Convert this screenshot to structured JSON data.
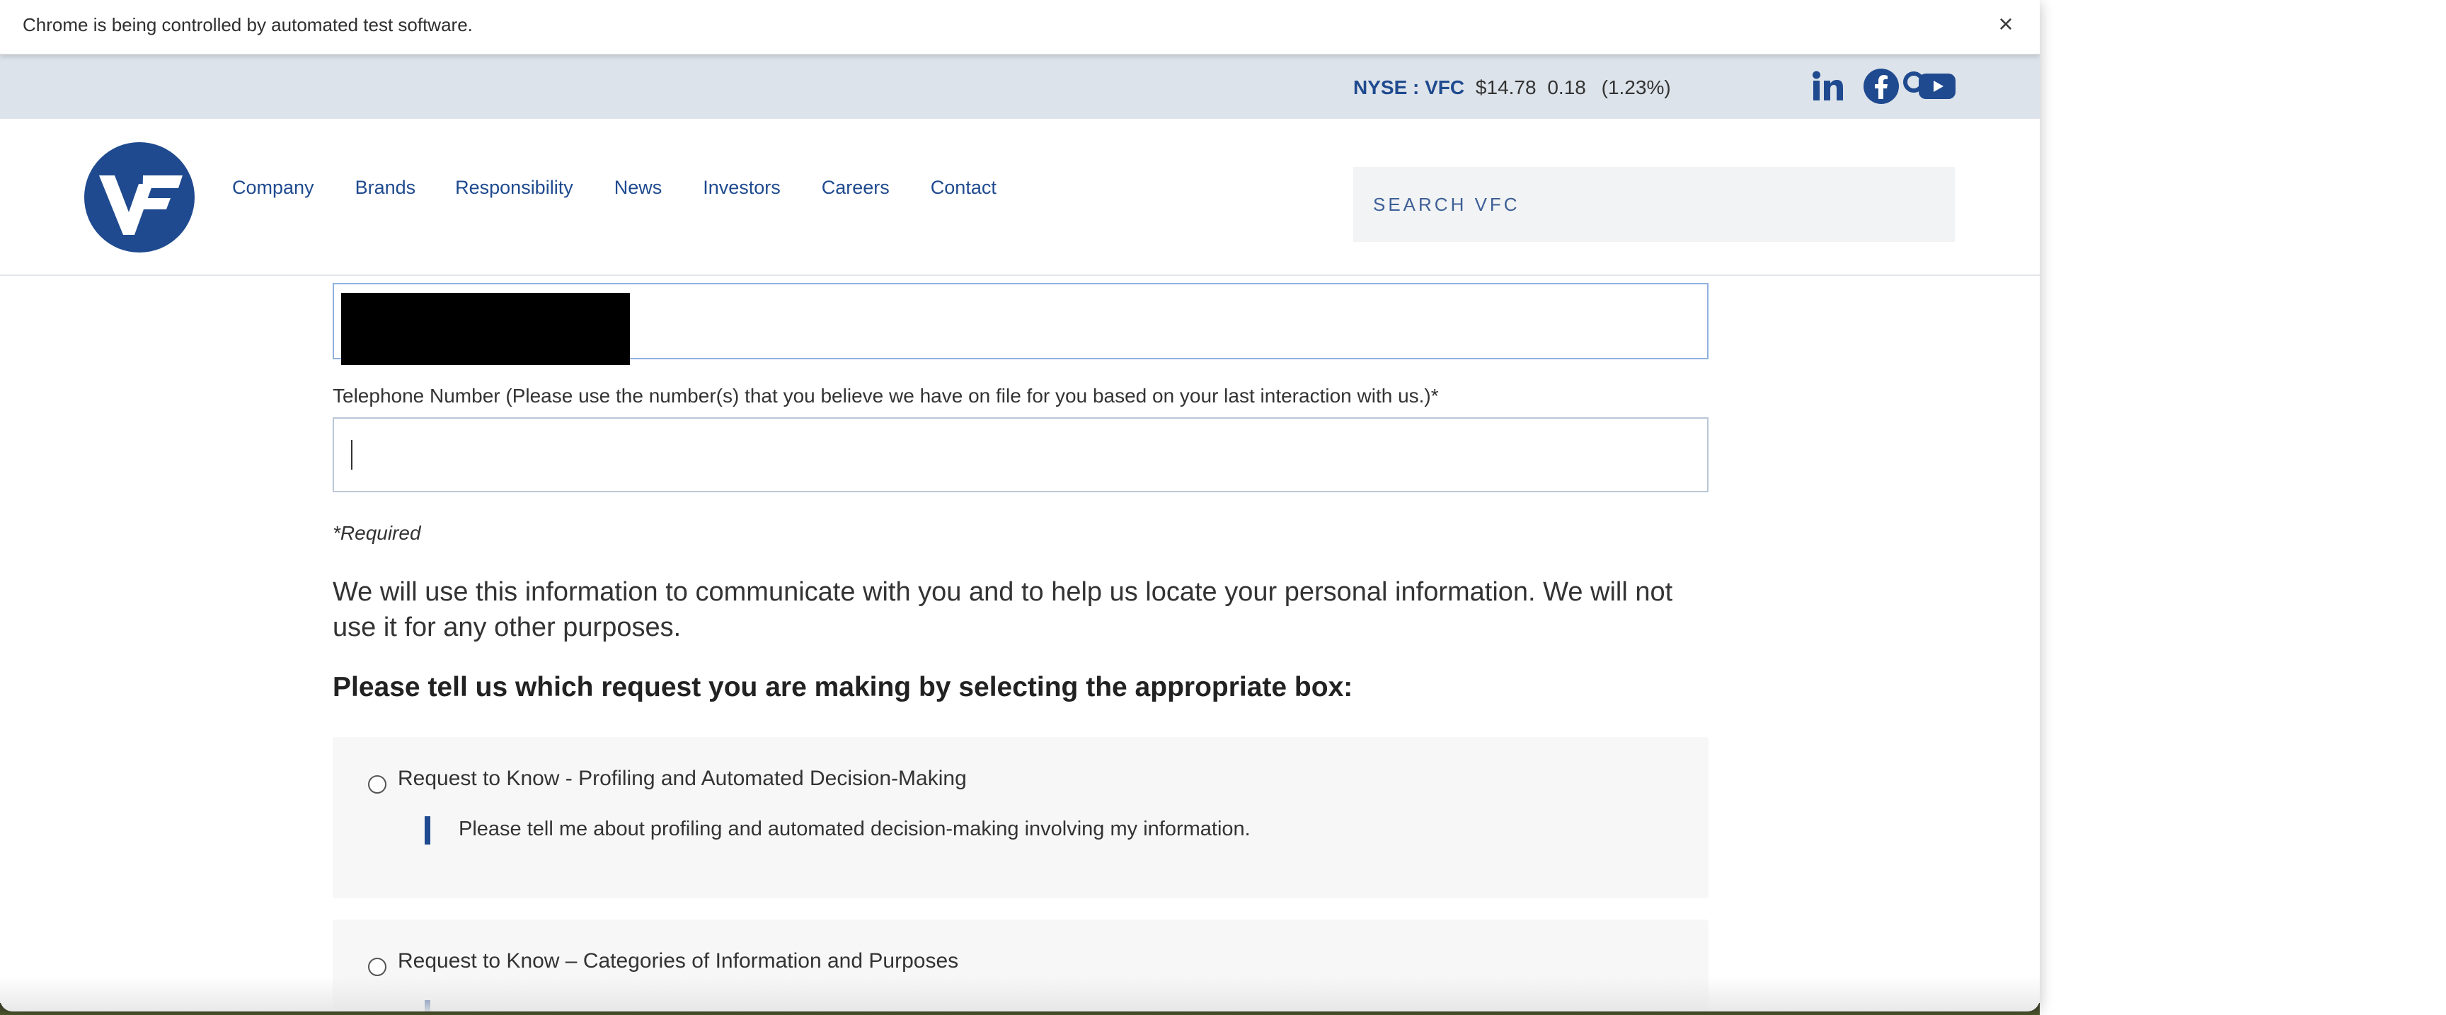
{
  "browser": {
    "automation_notice": "Chrome is being controlled by automated test software.",
    "close_glyph": "×"
  },
  "ticker": {
    "symbol": "NYSE : VFC",
    "price": "$14.78",
    "change": "0.18",
    "percent": "(1.23%)"
  },
  "social": {
    "icons": [
      "linkedin-icon",
      "facebook-icon",
      "youtube-icon"
    ],
    "color": "#1f4a8f"
  },
  "header": {
    "logo_text": "VF",
    "nav": [
      "Company",
      "Brands",
      "Responsibility",
      "News",
      "Investors",
      "Careers",
      "Contact"
    ],
    "search_placeholder": "SEARCH VFC",
    "search_icon": "search-icon"
  },
  "form": {
    "phone_label": "Telephone Number (Please use the number(s) that you believe we have on file for you based on your last interaction with us.)*",
    "phone_value": "",
    "required_note": "*Required",
    "info_paragraph": "We will use this information to communicate with you and to help us locate your personal information. We will not use it for any other purposes.",
    "request_heading": "Please tell us which request you are making by selecting the appropriate box:",
    "options": [
      {
        "title": "Request to Know - Profiling and Automated Decision-Making",
        "description": "Please tell me about profiling and automated decision-making involving my information.",
        "selected": false
      },
      {
        "title": "Request to Know – Categories of Information and Purposes",
        "description": "",
        "selected": false
      }
    ]
  },
  "colors": {
    "brand_blue": "#1f4a8f",
    "ticker_bar": "#dde3ea",
    "field_focus_border": "#8fb1e0"
  }
}
